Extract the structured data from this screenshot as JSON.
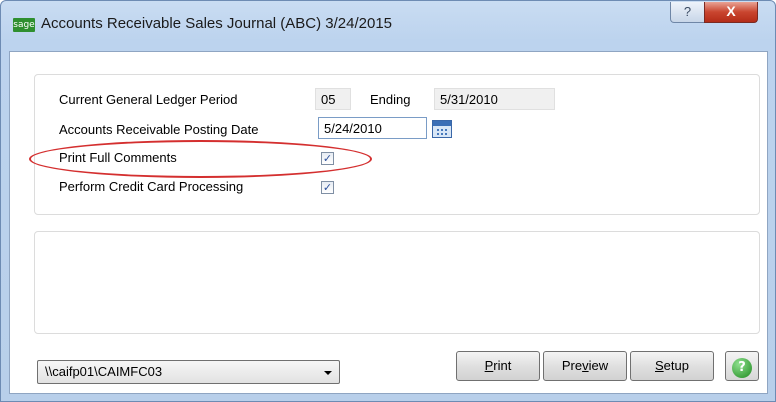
{
  "window": {
    "title": "Accounts Receivable Sales Journal (ABC) 3/24/2015",
    "app_icon_text": "sage",
    "help_symbol": "?",
    "close_symbol": "X"
  },
  "form": {
    "gl_period_label": "Current General Ledger Period",
    "gl_period_value": "05",
    "ending_label": "Ending",
    "ending_value": "5/31/2010",
    "posting_date_label": "Accounts Receivable Posting Date",
    "posting_date_value": "5/24/2010",
    "print_full_comments_label": "Print Full Comments",
    "print_full_comments_checked": true,
    "credit_card_label": "Perform Credit Card Processing",
    "credit_card_checked": true,
    "check_glyph": "✓"
  },
  "annotation": {
    "highlight_color": "#d42f2f"
  },
  "footer": {
    "printer_value": "\\\\caifp01\\CAIMFC03",
    "print_button": {
      "pre": "",
      "key": "P",
      "post": "rint"
    },
    "preview_button": {
      "pre": "Pre",
      "key": "v",
      "post": "iew"
    },
    "setup_button": {
      "pre": "",
      "key": "S",
      "post": "etup"
    },
    "help_symbol": "?"
  },
  "icons": {
    "calendar": "calendar-icon",
    "help": "help-icon",
    "close": "close-icon",
    "dropdown": "chevron-down-icon"
  }
}
